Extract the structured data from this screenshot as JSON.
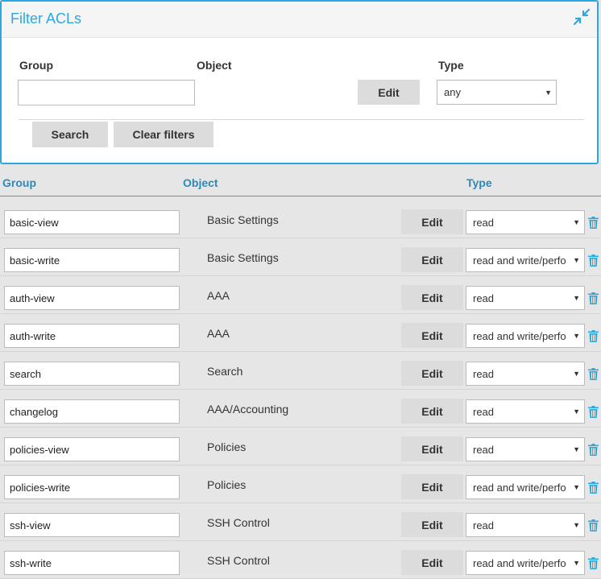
{
  "filter": {
    "title": "Filter ACLs",
    "group_label": "Group",
    "object_label": "Object",
    "type_label": "Type",
    "group_value": "",
    "edit_label": "Edit",
    "type_value": "any",
    "search_label": "Search",
    "clear_label": "Clear filters"
  },
  "table": {
    "col_group": "Group",
    "col_object": "Object",
    "col_type": "Type",
    "edit_label": "Edit",
    "rows": [
      {
        "group": "basic-view",
        "object": "Basic Settings",
        "type": "read"
      },
      {
        "group": "basic-write",
        "object": "Basic Settings",
        "type": "read and write/perfo"
      },
      {
        "group": "auth-view",
        "object": "AAA",
        "type": "read"
      },
      {
        "group": "auth-write",
        "object": "AAA",
        "type": "read and write/perfo"
      },
      {
        "group": "search",
        "object": "Search",
        "type": "read"
      },
      {
        "group": "changelog",
        "object": "AAA/Accounting",
        "type": "read"
      },
      {
        "group": "policies-view",
        "object": "Policies",
        "type": "read"
      },
      {
        "group": "policies-write",
        "object": "Policies",
        "type": "read and write/perfo"
      },
      {
        "group": "ssh-view",
        "object": "SSH Control",
        "type": "read"
      },
      {
        "group": "ssh-write",
        "object": "SSH Control",
        "type": "read and write/perfo"
      }
    ]
  },
  "colors": {
    "accent": "#2aa9e0",
    "header_text": "#2c89b8",
    "button_bg": "#dcdcdc",
    "background": "#e6e6e6"
  },
  "icons": {
    "collapse": "collapse-arrows-icon",
    "delete": "trash-icon",
    "dropdown": "chevron-down-icon"
  }
}
